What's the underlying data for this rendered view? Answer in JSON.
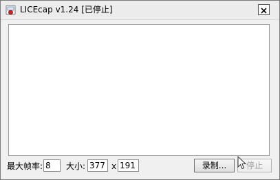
{
  "window": {
    "title": "LICEcap v1.24 [已停止]",
    "close_label": "X"
  },
  "controls": {
    "max_fps_label": "最大帧率:",
    "max_fps_value": "8",
    "size_label": "大小:",
    "width_value": "377",
    "x_separator": "x",
    "height_value": "191",
    "record_button": "录制...",
    "stop_button": "停止"
  },
  "icons": {
    "app": "licecap-app-icon",
    "close": "close-icon",
    "cursor": "mouse-cursor-icon"
  }
}
